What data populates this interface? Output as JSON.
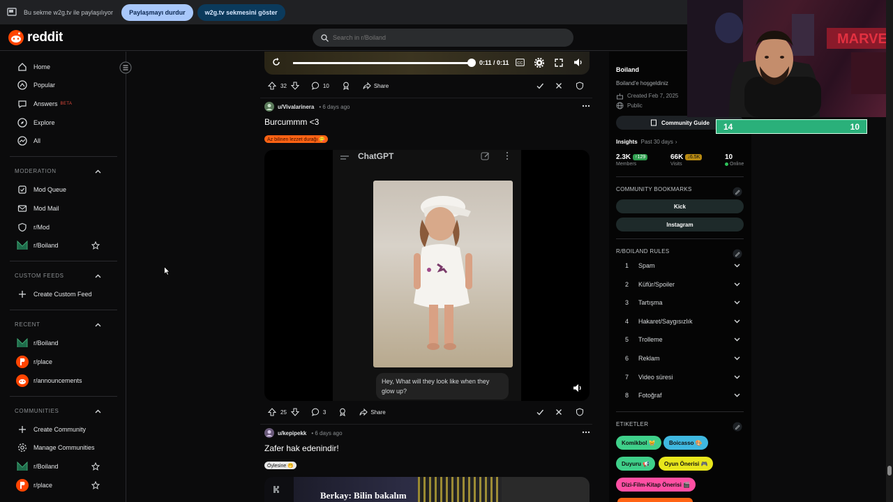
{
  "share_banner": {
    "text": "Bu sekme w2g.tv ile paylaşılıyor",
    "stop_button": "Paylaşmayı durdur",
    "show_button": "w2g.tv sekmesini göster"
  },
  "header": {
    "logo_text": "reddit",
    "search_placeholder": "Search in r/Boiland"
  },
  "sidebar": {
    "main": [
      {
        "label": "Home",
        "icon": "home-icon"
      },
      {
        "label": "Popular",
        "icon": "popular-icon"
      },
      {
        "label": "Answers",
        "icon": "answers-icon",
        "badge": "BETA"
      },
      {
        "label": "Explore",
        "icon": "explore-icon"
      },
      {
        "label": "All",
        "icon": "all-icon"
      }
    ],
    "moderation": {
      "title": "MODERATION",
      "items": [
        "Mod Queue",
        "Mod Mail",
        "r/Mod",
        "r/Boiland"
      ]
    },
    "custom_feeds": {
      "title": "CUSTOM FEEDS",
      "items": [
        "Create Custom Feed"
      ]
    },
    "recent": {
      "title": "RECENT",
      "items": [
        "r/Boiland",
        "r/place",
        "r/announcements"
      ]
    },
    "communities": {
      "title": "COMMUNITIES",
      "items": [
        "Create Community",
        "Manage Communities",
        "r/Boiland",
        "r/place"
      ]
    }
  },
  "video_player": {
    "time": "0:11 / 0:11",
    "progress": 1.0
  },
  "posts": [
    {
      "upvotes": "32",
      "comments": "10",
      "share": "Share"
    },
    {
      "author": "u/Vivalarinera",
      "age": "• 6 days ago",
      "title": "Burcummm <3",
      "flair": "Az bilinen lezzet durağı 😋",
      "image_header": "ChatGPT",
      "image_caption": "Hey, What will they look like when they glow up?",
      "upvotes": "25",
      "comments": "3",
      "share": "Share"
    },
    {
      "author": "u/kepipekk",
      "age": "• 6 days ago",
      "title": "Zafer hak edenindir!",
      "flair": "Öylesine 🤭",
      "preview_text": "Berkay: Bilin bakalım"
    }
  ],
  "community": {
    "name": "Boiland",
    "description": "Boiland'e hoşgeldiniz",
    "created": "Created Feb 7, 2025",
    "visibility": "Public",
    "guide_button": "Community Guide",
    "insights_label": "Insights",
    "insights_period": "Past 30 days",
    "stats": [
      {
        "value": "2.3K",
        "delta": "↑129",
        "label": "Members",
        "delta_color": "#2e9d4e"
      },
      {
        "value": "66K",
        "delta": "↓6.5K",
        "label": "Visits",
        "delta_color": "#b88a12"
      },
      {
        "value": "10",
        "delta": "",
        "label": "Online"
      }
    ],
    "bookmarks_title": "COMMUNITY BOOKMARKS",
    "bookmarks": [
      "Kick",
      "Instagram"
    ],
    "rules_title": "R/BOILAND RULES",
    "rules": [
      "Spam",
      "Küfür/Spoiler",
      "Tartışma",
      "Hakaret/Saygısızlık",
      "Trolleme",
      "Reklam",
      "Video süresi",
      "Fotoğraf"
    ],
    "tags_title": "ETIKETLER",
    "tags": [
      {
        "label": "Komikbol 😹",
        "color": "#3fd08a"
      },
      {
        "label": "Boicasso 🎨",
        "color": "#3fb8e0"
      },
      {
        "label": "Duyuru 📢",
        "color": "#3fd08a"
      },
      {
        "label": "Oyun Önerisi 🎮",
        "color": "#e8e61c"
      },
      {
        "label": "Dizi-Film-Kitap Önerisi 🎬",
        "color": "#ff4fa3"
      }
    ]
  },
  "overlay_counter": {
    "left": "14",
    "right": "10"
  },
  "colors": {
    "accent": "#ff4500",
    "banner_pill_stop": "#a8c7fa",
    "banner_pill_show": "#0b3a5c"
  }
}
